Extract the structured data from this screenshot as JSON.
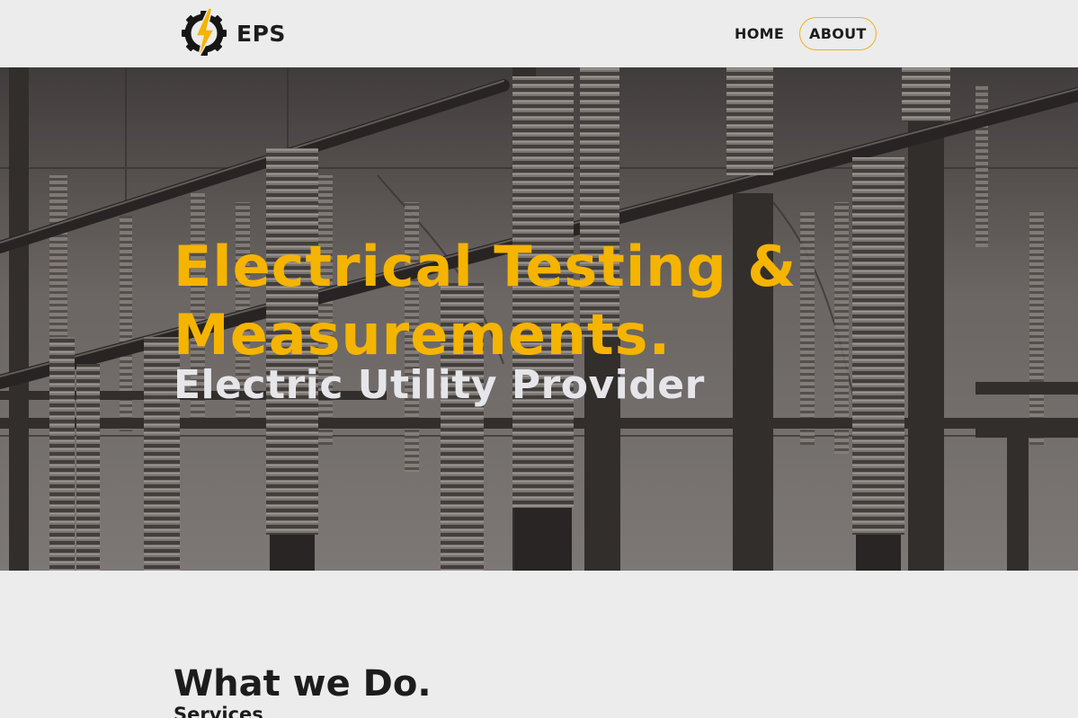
{
  "nav": {
    "brand": "EPS",
    "links": [
      {
        "label": "HOME",
        "active": false
      },
      {
        "label": "ABOUT",
        "active": true
      }
    ]
  },
  "hero": {
    "title": "Electrical Testing & Measurements.",
    "subtitle": "Electric Utility Provider"
  },
  "services": {
    "title": "What we Do.",
    "subtitle": "Services"
  },
  "colors": {
    "accent": "#f5b400",
    "text_dark": "#1c1c1c",
    "background": "#ececec"
  },
  "icons": [
    "gear-bolt-logo-icon"
  ]
}
